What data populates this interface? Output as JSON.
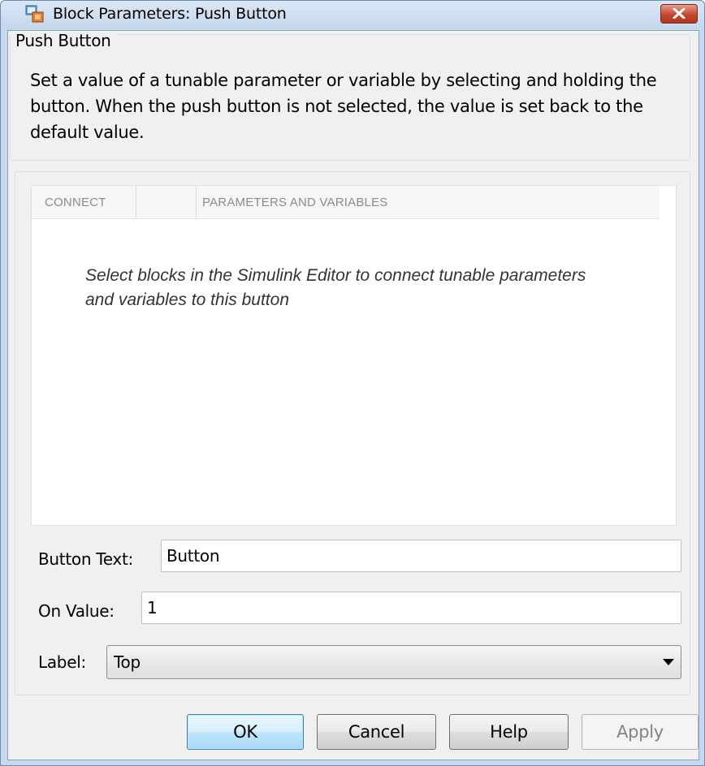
{
  "window": {
    "title": "Block Parameters: Push Button",
    "close_icon": "close-x-icon",
    "app_icon": "simulink-block-icon"
  },
  "description_group": {
    "legend": "Push Button",
    "text": "Set a value of a tunable parameter or variable by selecting and holding the button. When the push button is not selected, the value is set back to the default value."
  },
  "connect_table": {
    "columns": [
      "CONNECT",
      "",
      "PARAMETERS AND VARIABLES"
    ],
    "empty_message": "Select blocks in the Simulink Editor to connect tunable parameters and variables to this button"
  },
  "fields": {
    "button_text": {
      "label": "Button Text:",
      "value": "Button"
    },
    "on_value": {
      "label": "On Value:",
      "value": "1"
    },
    "label": {
      "label": "Label:",
      "selected": "Top",
      "icon": "dropdown-arrow-icon"
    }
  },
  "buttons": {
    "ok": "OK",
    "cancel": "Cancel",
    "help": "Help",
    "apply": "Apply"
  },
  "colors": {
    "titlebar": "#c4d6ec",
    "close_button": "#c5472f",
    "default_button_border": "#3c7fb1"
  }
}
